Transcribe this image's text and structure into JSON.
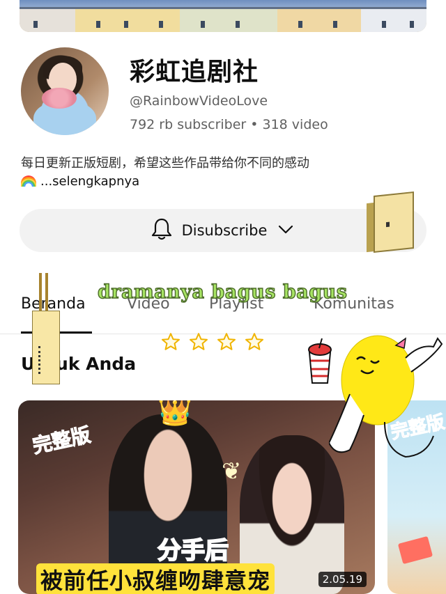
{
  "channel": {
    "name": "彩虹追剧社",
    "handle": "@RainbowVideoLove",
    "stats": "792 rb subscriber • 318 video",
    "description": "每日更新正版短剧，希望这些作品带给你不同的感动",
    "more_label": "...selengkapnya"
  },
  "subscribe": {
    "label": "Disubscribe"
  },
  "tabs": [
    {
      "label": "Beranda",
      "active": true
    },
    {
      "label": "Video",
      "active": false
    },
    {
      "label": "Playlist",
      "active": false
    },
    {
      "label": "Komunitas",
      "active": false
    }
  ],
  "section": {
    "title": "Untuk Anda"
  },
  "videos": [
    {
      "badge": "完整版",
      "caption_line1": "分手后",
      "caption_line2": "被前任小叔缠吻肆意宠",
      "duration": "2.05.19"
    },
    {
      "badge": "完整版"
    }
  ],
  "overlay": {
    "sticker_text": "dramanya bagus bagus",
    "star_count": 4
  },
  "icons": {
    "bell": "bell-icon",
    "chevron": "chevron-down-icon",
    "rainbow": "rainbow-icon",
    "star": "star-icon"
  }
}
